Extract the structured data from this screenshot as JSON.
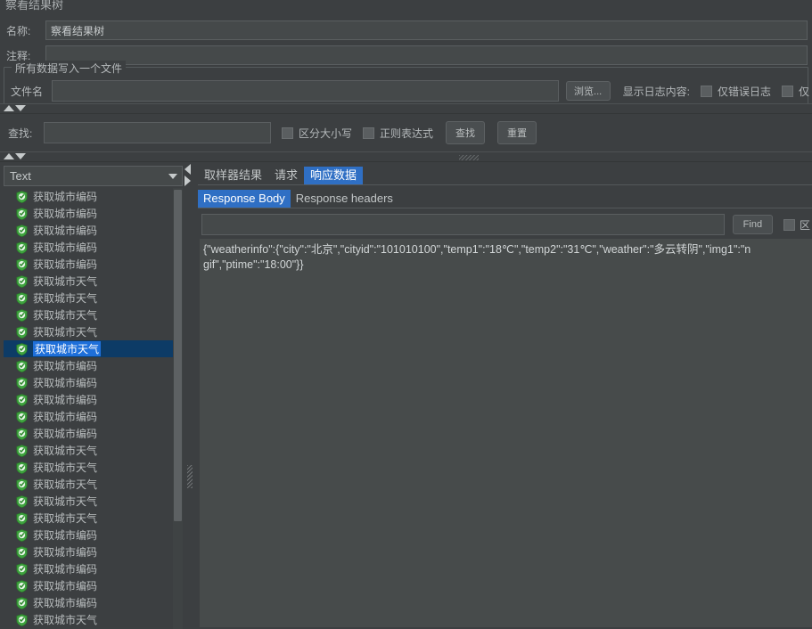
{
  "window": {
    "title": "察看结果树"
  },
  "form": {
    "name_label": "名称:",
    "name_value": "察看结果树",
    "comment_label": "注释:",
    "comment_value": "",
    "group_title": "所有数据写入一个文件",
    "filename_label": "文件名",
    "filename_value": "",
    "browse_button": "浏览...",
    "log_display_label": "显示日志内容:",
    "error_only_label": "仅错误日志",
    "successes_label": "仅"
  },
  "search": {
    "find_label": "查找:",
    "find_value": "",
    "case_sensitive_label": "区分大小写",
    "regex_label": "正则表达式",
    "find_button": "查找",
    "reset_button": "重置"
  },
  "tree": {
    "render_selector_value": "Text",
    "items": [
      {
        "label": "获取城市编码",
        "selected": false
      },
      {
        "label": "获取城市编码",
        "selected": false
      },
      {
        "label": "获取城市编码",
        "selected": false
      },
      {
        "label": "获取城市编码",
        "selected": false
      },
      {
        "label": "获取城市编码",
        "selected": false
      },
      {
        "label": "获取城市天气",
        "selected": false
      },
      {
        "label": "获取城市天气",
        "selected": false
      },
      {
        "label": "获取城市天气",
        "selected": false
      },
      {
        "label": "获取城市天气",
        "selected": false
      },
      {
        "label": "获取城市天气",
        "selected": true
      },
      {
        "label": "获取城市编码",
        "selected": false
      },
      {
        "label": "获取城市编码",
        "selected": false
      },
      {
        "label": "获取城市编码",
        "selected": false
      },
      {
        "label": "获取城市编码",
        "selected": false
      },
      {
        "label": "获取城市编码",
        "selected": false
      },
      {
        "label": "获取城市天气",
        "selected": false
      },
      {
        "label": "获取城市天气",
        "selected": false
      },
      {
        "label": "获取城市天气",
        "selected": false
      },
      {
        "label": "获取城市天气",
        "selected": false
      },
      {
        "label": "获取城市天气",
        "selected": false
      },
      {
        "label": "获取城市编码",
        "selected": false
      },
      {
        "label": "获取城市编码",
        "selected": false
      },
      {
        "label": "获取城市编码",
        "selected": false
      },
      {
        "label": "获取城市编码",
        "selected": false
      },
      {
        "label": "获取城市编码",
        "selected": false
      },
      {
        "label": "获取城市天气",
        "selected": false
      }
    ]
  },
  "content": {
    "tabs": [
      {
        "label": "取样器结果",
        "active": false
      },
      {
        "label": "请求",
        "active": false
      },
      {
        "label": "响应数据",
        "active": true
      }
    ],
    "subtabs": [
      {
        "label": "Response Body",
        "active": true
      },
      {
        "label": "Response headers",
        "active": false
      }
    ],
    "find_value": "",
    "find_button": "Find",
    "case_label": "区",
    "response_lines": [
      "{\"weatherinfo\":{\"city\":\"北京\",\"cityid\":\"101010100\",\"temp1\":\"18℃\",\"temp2\":\"31℃\",\"weather\":\"多云转阴\",\"img1\":\"n",
      "gif\",\"ptime\":\"18:00\"}}"
    ]
  },
  "colors": {
    "background": "#3c3f41",
    "field": "#45494a",
    "accent": "#2f6fc4",
    "selection": "#1e6fd9",
    "response_bg": "#474b4b",
    "shield_green": "#3fa33f"
  }
}
